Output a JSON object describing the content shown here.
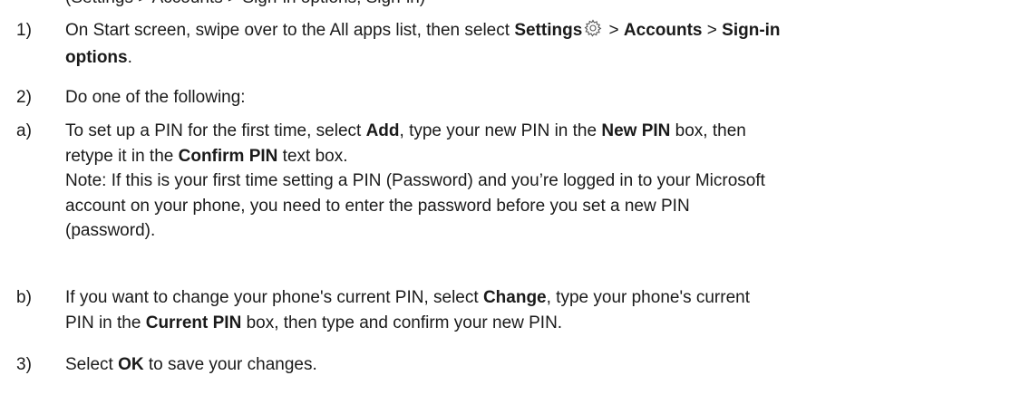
{
  "top_clipped_text": "(Settings > Accounts > Sign-in options, Sign-in)",
  "steps": [
    {
      "marker": "1)",
      "parts": {
        "a": "On Start screen, swipe over to the All apps list, then select ",
        "b_settings": "Settings",
        "c": " > ",
        "d_accounts": "Accounts",
        "e": " > ",
        "f_signin": "Sign-in",
        "g_options": "options",
        "h": "."
      },
      "icon": "settings-gear-icon"
    },
    {
      "marker": "2)",
      "text": "Do one of the following:"
    },
    {
      "marker": "a)",
      "parts": {
        "a": "To set up a PIN for the first time, select ",
        "b_add": "Add",
        "c": ", type your new PIN in the ",
        "d_newpin": "New PIN",
        "e": " box, then",
        "f": "retype it in the ",
        "g_confirm": "Confirm PIN",
        "h": " text box."
      },
      "note_lines": [
        "Note: If this is your first time setting a PIN (Password) and you’re logged in to your Microsoft",
        "account on your phone, you need to enter the password before you set a new PIN",
        "(password)."
      ]
    },
    {
      "marker": "b)",
      "parts": {
        "a": "If you want to change your phone's current PIN, select ",
        "b_change": "Change",
        "c": ", type your phone's current",
        "d": "PIN in the ",
        "e_current": "Current PIN",
        "f": " box, then type and confirm your new PIN."
      }
    },
    {
      "marker": "3)",
      "parts": {
        "a": "Select ",
        "b_ok": "OK",
        "c": " to save your changes."
      }
    }
  ]
}
